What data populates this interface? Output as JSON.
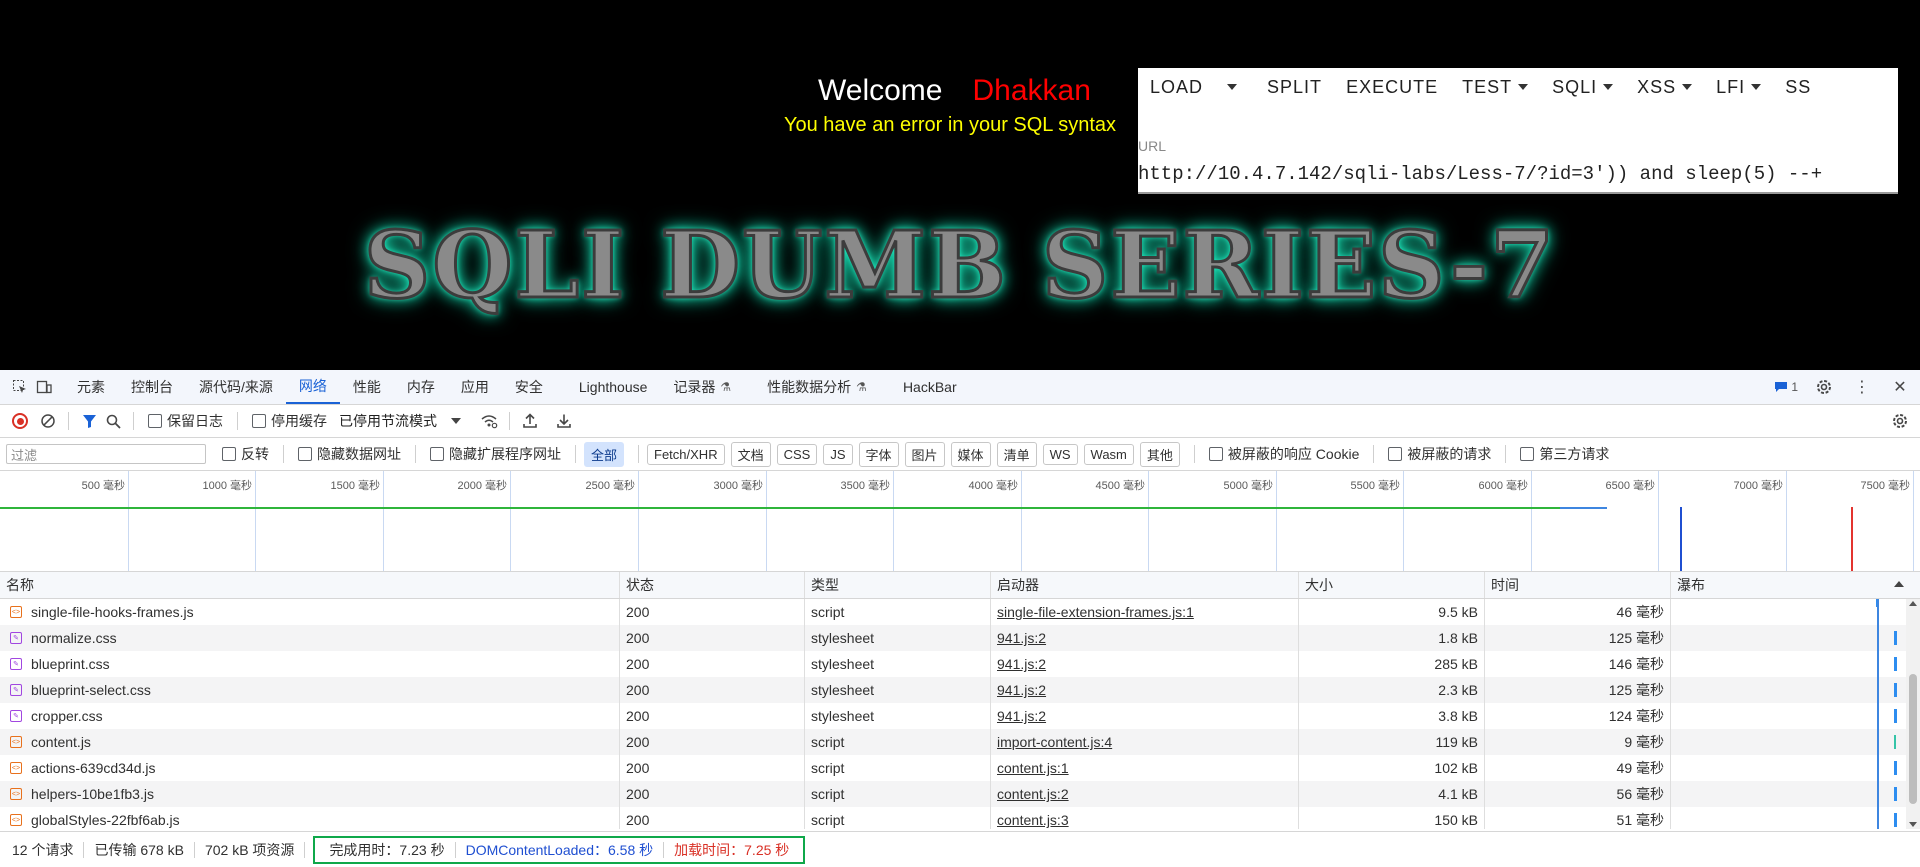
{
  "page": {
    "welcome_label": "Welcome",
    "username": "Dhakkan",
    "error_message": "You have an error in your SQL syntax",
    "title_image_text": "SQLI DUMB SERIES-7"
  },
  "hackbar": {
    "menu": [
      "LOAD",
      "SPLIT",
      "EXECUTE",
      "TEST",
      "SQLI",
      "XSS",
      "LFI",
      "SS"
    ],
    "url_label": "URL",
    "url_value": "http://10.4.7.142/sqli-labs/Less-7/?id=3')) and sleep(5) --+"
  },
  "devtools": {
    "tabs": [
      "元素",
      "控制台",
      "源代码/来源",
      "网络",
      "性能",
      "内存",
      "应用",
      "安全",
      "Lighthouse",
      "记录器",
      "性能数据分析",
      "HackBar"
    ],
    "active_tab": "网络",
    "issues_count": "1",
    "toolbar": {
      "preserve_log": "保留日志",
      "disable_cache": "停用缓存",
      "throttle": "已停用节流模式"
    },
    "filter": {
      "placeholder": "过滤",
      "invert": "反转",
      "hide_data_urls": "隐藏数据网址",
      "hide_ext_urls": "隐藏扩展程序网址",
      "types": [
        "全部",
        "Fetch/XHR",
        "文档",
        "CSS",
        "JS",
        "字体",
        "图片",
        "媒体",
        "清单",
        "WS",
        "Wasm",
        "其他"
      ],
      "blocked_cookies": "被屏蔽的响应 Cookie",
      "blocked_requests": "被屏蔽的请求",
      "third_party": "第三方请求"
    },
    "overview_ticks": [
      "500 毫秒",
      "1000 毫秒",
      "1500 毫秒",
      "2000 毫秒",
      "2500 毫秒",
      "3000 毫秒",
      "3500 毫秒",
      "4000 毫秒",
      "4500 毫秒",
      "5000 毫秒",
      "5500 毫秒",
      "6000 毫秒",
      "6500 毫秒",
      "7000 毫秒",
      "7500 毫秒"
    ],
    "columns": {
      "name": "名称",
      "status": "状态",
      "type": "类型",
      "initiator": "启动器",
      "size": "大小",
      "time": "时间",
      "waterfall": "瀑布"
    },
    "rows": [
      {
        "name": "single-file-hooks-frames.js",
        "status": "200",
        "type": "script",
        "initiator": "single-file-extension-frames.js:1",
        "size": "9.5 kB",
        "time": "46 毫秒",
        "kind": "js"
      },
      {
        "name": "normalize.css",
        "status": "200",
        "type": "stylesheet",
        "initiator": "941.js:2",
        "size": "1.8 kB",
        "time": "125 毫秒",
        "kind": "css"
      },
      {
        "name": "blueprint.css",
        "status": "200",
        "type": "stylesheet",
        "initiator": "941.js:2",
        "size": "285 kB",
        "time": "146 毫秒",
        "kind": "css"
      },
      {
        "name": "blueprint-select.css",
        "status": "200",
        "type": "stylesheet",
        "initiator": "941.js:2",
        "size": "2.3 kB",
        "time": "125 毫秒",
        "kind": "css"
      },
      {
        "name": "cropper.css",
        "status": "200",
        "type": "stylesheet",
        "initiator": "941.js:2",
        "size": "3.8 kB",
        "time": "124 毫秒",
        "kind": "css"
      },
      {
        "name": "content.js",
        "status": "200",
        "type": "script",
        "initiator": "import-content.js:4",
        "size": "119 kB",
        "time": "9 毫秒",
        "kind": "js"
      },
      {
        "name": "actions-639cd34d.js",
        "status": "200",
        "type": "script",
        "initiator": "content.js:1",
        "size": "102 kB",
        "time": "49 毫秒",
        "kind": "js"
      },
      {
        "name": "helpers-10be1fb3.js",
        "status": "200",
        "type": "script",
        "initiator": "content.js:2",
        "size": "4.1 kB",
        "time": "56 毫秒",
        "kind": "js"
      },
      {
        "name": "globalStyles-22fbf6ab.js",
        "status": "200",
        "type": "script",
        "initiator": "content.js:3",
        "size": "150 kB",
        "time": "51 毫秒",
        "kind": "js"
      }
    ],
    "status_bar": {
      "requests": "12 个请求",
      "transferred": "已传输 678 kB",
      "resources": "702 kB 项资源",
      "finish": "完成用时：7.23 秒",
      "dcl": "DOMContentLoaded：6.58 秒",
      "load": "加载时间：7.25 秒"
    },
    "colors": {
      "accent": "#1a62d6",
      "dcl": "#1f4fd1",
      "load": "#d93025",
      "highlight_box": "#0fa84a"
    }
  }
}
